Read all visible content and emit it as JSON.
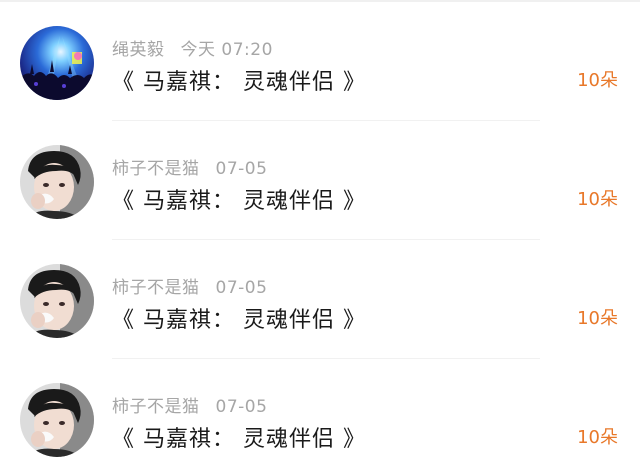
{
  "items": [
    {
      "author": "绳英毅",
      "time": "今天 07:20",
      "title": "《 马嘉祺：  灵魂伴侣 》",
      "count": "10朵",
      "avatar_icon": "concert-crowd-avatar"
    },
    {
      "author": "柿子不是猫",
      "time": "07-05",
      "title": "《 马嘉祺：  灵魂伴侣 》",
      "count": "10朵",
      "avatar_icon": "portrait-avatar"
    },
    {
      "author": "柿子不是猫",
      "time": "07-05",
      "title": "《 马嘉祺：  灵魂伴侣 》",
      "count": "10朵",
      "avatar_icon": "portrait-avatar"
    },
    {
      "author": "柿子不是猫",
      "time": "07-05",
      "title": "《 马嘉祺：  灵魂伴侣 》",
      "count": "10朵",
      "avatar_icon": "portrait-avatar"
    }
  ],
  "colors": {
    "count": "#e8782a",
    "meta": "#a6a6a6",
    "title": "#1a1a1a"
  }
}
